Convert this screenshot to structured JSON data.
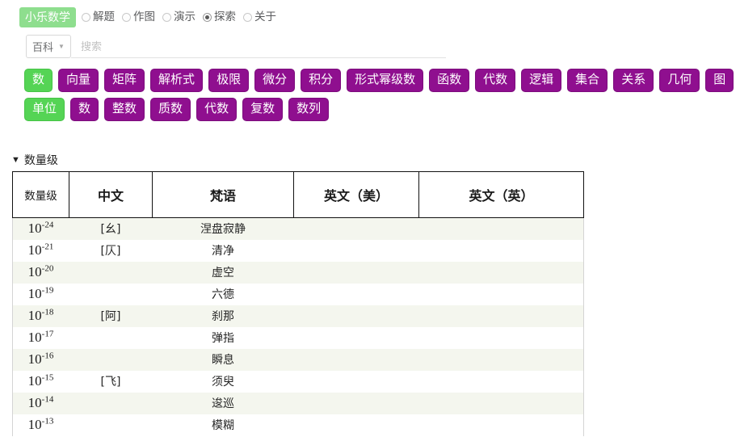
{
  "header": {
    "logo": "小乐数学",
    "nav": [
      {
        "label": "解题",
        "selected": false
      },
      {
        "label": "作图",
        "selected": false
      },
      {
        "label": "演示",
        "selected": false
      },
      {
        "label": "探索",
        "selected": true
      },
      {
        "label": "关于",
        "selected": false
      }
    ]
  },
  "search": {
    "scope_label": "百科",
    "caret_icon": "chevron-down-icon",
    "placeholder": "搜索",
    "value": ""
  },
  "tags": {
    "row1": [
      {
        "label": "数",
        "active": true
      },
      {
        "label": "向量",
        "active": false
      },
      {
        "label": "矩阵",
        "active": false
      },
      {
        "label": "解析式",
        "active": false
      },
      {
        "label": "极限",
        "active": false
      },
      {
        "label": "微分",
        "active": false
      },
      {
        "label": "积分",
        "active": false
      },
      {
        "label": "形式幂级数",
        "active": false
      },
      {
        "label": "函数",
        "active": false
      },
      {
        "label": "代数",
        "active": false
      },
      {
        "label": "逻辑",
        "active": false
      },
      {
        "label": "集合",
        "active": false
      },
      {
        "label": "关系",
        "active": false
      },
      {
        "label": "几何",
        "active": false
      },
      {
        "label": "图",
        "active": false
      }
    ],
    "row2": [
      {
        "label": "单位",
        "active": true
      },
      {
        "label": "数",
        "active": false
      },
      {
        "label": "整数",
        "active": false
      },
      {
        "label": "质数",
        "active": false
      },
      {
        "label": "代数",
        "active": false
      },
      {
        "label": "复数",
        "active": false
      },
      {
        "label": "数列",
        "active": false
      }
    ]
  },
  "section": {
    "toggle_icon": "triangle-down-icon",
    "title": "数量级"
  },
  "table": {
    "columns": [
      "数量级",
      "中文",
      "梵语",
      "英文（美）",
      "英文（英）"
    ],
    "rows": [
      {
        "exp": "-24",
        "base": "10",
        "zh": "[幺]",
        "sanskrit": "涅盘寂静",
        "en_us": "",
        "en_uk": ""
      },
      {
        "exp": "-21",
        "base": "10",
        "zh": "[仄]",
        "sanskrit": "清净",
        "en_us": "",
        "en_uk": ""
      },
      {
        "exp": "-20",
        "base": "10",
        "zh": "",
        "sanskrit": "虚空",
        "en_us": "",
        "en_uk": ""
      },
      {
        "exp": "-19",
        "base": "10",
        "zh": "",
        "sanskrit": "六德",
        "en_us": "",
        "en_uk": ""
      },
      {
        "exp": "-18",
        "base": "10",
        "zh": "[阿]",
        "sanskrit": "刹那",
        "en_us": "",
        "en_uk": ""
      },
      {
        "exp": "-17",
        "base": "10",
        "zh": "",
        "sanskrit": "弹指",
        "en_us": "",
        "en_uk": ""
      },
      {
        "exp": "-16",
        "base": "10",
        "zh": "",
        "sanskrit": "瞬息",
        "en_us": "",
        "en_uk": ""
      },
      {
        "exp": "-15",
        "base": "10",
        "zh": "[飞]",
        "sanskrit": "须臾",
        "en_us": "",
        "en_uk": ""
      },
      {
        "exp": "-14",
        "base": "10",
        "zh": "",
        "sanskrit": "逡巡",
        "en_us": "",
        "en_uk": ""
      },
      {
        "exp": "-13",
        "base": "10",
        "zh": "",
        "sanskrit": "模糊",
        "en_us": "",
        "en_uk": ""
      }
    ]
  },
  "colors": {
    "logo_bg": "#8ede8e",
    "tag_bg": "#8f0f8f",
    "tag_active_bg": "#55d455",
    "row_alt_bg": "#f4f6ee"
  }
}
